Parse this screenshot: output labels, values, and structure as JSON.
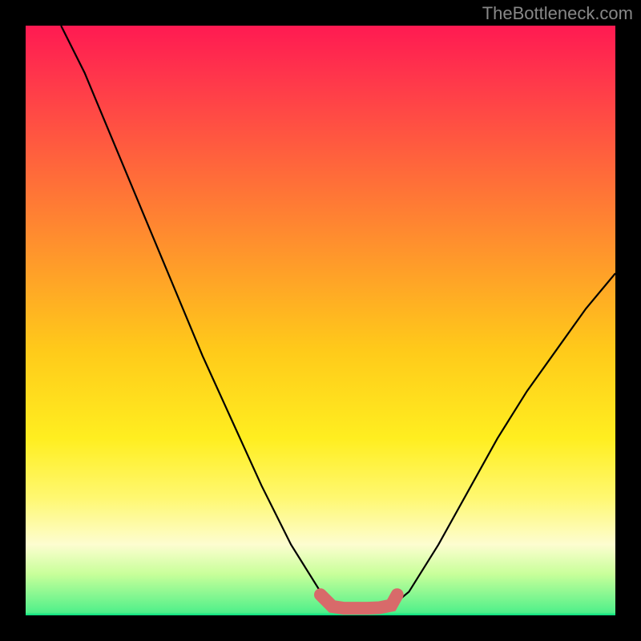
{
  "watermark": "TheBottleneck.com",
  "colors": {
    "curve": "#000000",
    "marker": "#d86a6a",
    "gradient_top": "#ff1a52",
    "gradient_bottom": "#00e080"
  },
  "marker_stroke_width": 16,
  "chart_data": {
    "type": "line",
    "title": "",
    "xlabel": "",
    "ylabel": "",
    "xlim": [
      0,
      100
    ],
    "ylim": [
      0,
      100
    ],
    "series": [
      {
        "name": "left-branch",
        "x": [
          6,
          10,
          15,
          20,
          25,
          30,
          35,
          40,
          45,
          50,
          52
        ],
        "y": [
          100,
          92,
          80,
          68,
          56,
          44,
          33,
          22,
          12,
          4,
          1.5
        ]
      },
      {
        "name": "right-branch",
        "x": [
          62,
          65,
          70,
          75,
          80,
          85,
          90,
          95,
          100
        ],
        "y": [
          1.5,
          4,
          12,
          21,
          30,
          38,
          45,
          52,
          58
        ]
      },
      {
        "name": "valley-marker",
        "x": [
          50,
          52,
          54,
          56,
          58,
          60,
          62,
          63
        ],
        "y": [
          3.5,
          1.5,
          1.2,
          1.2,
          1.2,
          1.3,
          1.7,
          3.5
        ]
      }
    ]
  }
}
